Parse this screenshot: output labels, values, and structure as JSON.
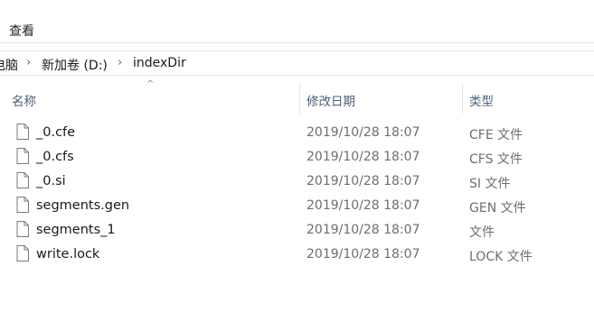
{
  "ribbon": {
    "view_tab": "查看"
  },
  "breadcrumb": {
    "items": [
      "电脑",
      "新加卷 (D:)",
      "indexDir"
    ]
  },
  "columns": {
    "name": "名称",
    "date": "修改日期",
    "type": "类型"
  },
  "files": [
    {
      "name": "_0.cfe",
      "date": "2019/10/28 18:07",
      "type": "CFE 文件"
    },
    {
      "name": "_0.cfs",
      "date": "2019/10/28 18:07",
      "type": "CFS 文件"
    },
    {
      "name": "_0.si",
      "date": "2019/10/28 18:07",
      "type": "SI 文件"
    },
    {
      "name": "segments.gen",
      "date": "2019/10/28 18:07",
      "type": "GEN 文件"
    },
    {
      "name": "segments_1",
      "date": "2019/10/28 18:07",
      "type": "文件"
    },
    {
      "name": "write.lock",
      "date": "2019/10/28 18:07",
      "type": "LOCK 文件"
    }
  ],
  "icons": {
    "file": "file-icon",
    "chevron": "chevron-right-icon",
    "sort": "sort-up-icon"
  }
}
